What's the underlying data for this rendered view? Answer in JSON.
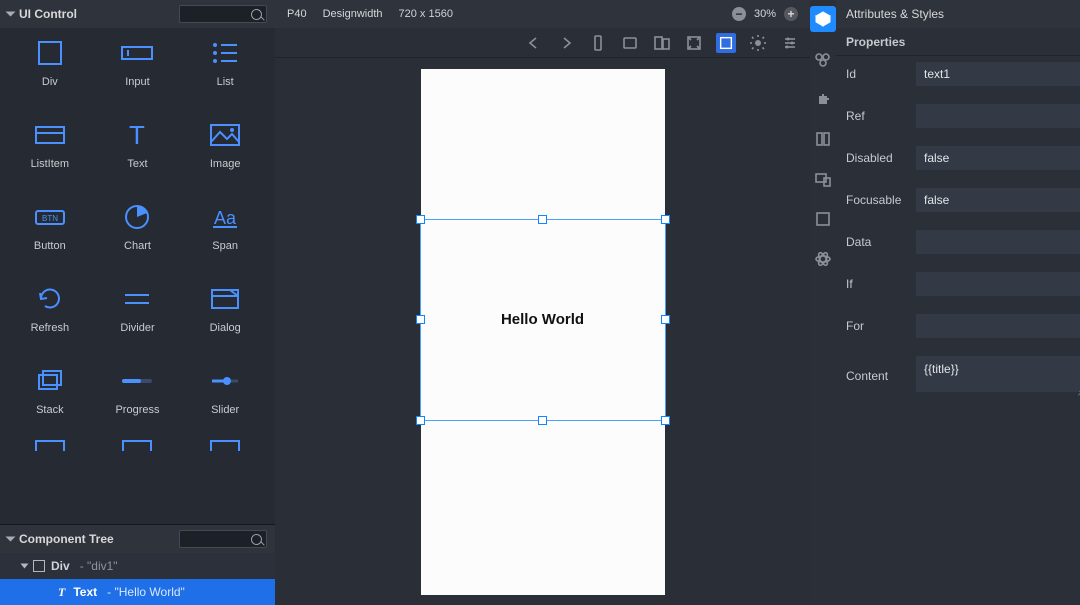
{
  "left_panel": {
    "title": "UI Control",
    "items": [
      {
        "name": "Div",
        "icon": "div"
      },
      {
        "name": "Input",
        "icon": "input"
      },
      {
        "name": "List",
        "icon": "list"
      },
      {
        "name": "ListItem",
        "icon": "listitem"
      },
      {
        "name": "Text",
        "icon": "text"
      },
      {
        "name": "Image",
        "icon": "image"
      },
      {
        "name": "Button",
        "icon": "button"
      },
      {
        "name": "Chart",
        "icon": "chart"
      },
      {
        "name": "Span",
        "icon": "span"
      },
      {
        "name": "Refresh",
        "icon": "refresh"
      },
      {
        "name": "Divider",
        "icon": "divider"
      },
      {
        "name": "Dialog",
        "icon": "dialog"
      },
      {
        "name": "Stack",
        "icon": "stack"
      },
      {
        "name": "Progress",
        "icon": "progress"
      },
      {
        "name": "Slider",
        "icon": "slider"
      }
    ]
  },
  "tree_panel": {
    "title": "Component Tree",
    "root": {
      "type": "Div",
      "id": "div1",
      "label": "Div",
      "subtitle": "- \"div1\""
    },
    "child": {
      "type": "Text",
      "label": "Text",
      "subtitle": "- \"Hello World\""
    }
  },
  "topbar": {
    "device": "P40",
    "designwidth_label": "Designwidth",
    "dimensions": "720 x 1560",
    "zoom_percent": "30%"
  },
  "canvas": {
    "text": "Hello World"
  },
  "right_panel": {
    "title": "Attributes & Styles",
    "section": "Properties",
    "props": {
      "Id": "text1",
      "Ref": "",
      "Disabled": "false",
      "Focusable": "false",
      "Data": "",
      "If": "",
      "For": "",
      "Content": "{{title}}"
    },
    "labels": {
      "Id": "Id",
      "Ref": "Ref",
      "Disabled": "Disabled",
      "Focusable": "Focusable",
      "Data": "Data",
      "If": "If",
      "For": "For",
      "Content": "Content"
    }
  }
}
